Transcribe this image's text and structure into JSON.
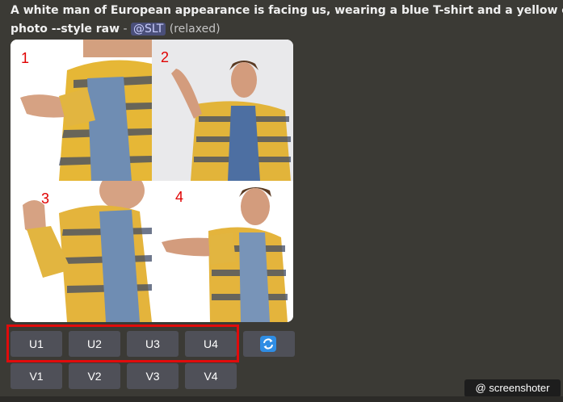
{
  "message": {
    "prompt_text": "A white man of European appearance is facing us, wearing a blue T-shirt and a yellow checkered s",
    "prompt_text_line2": "photo --style raw",
    "separator": " - ",
    "mention": "@SLT",
    "status": "(relaxed)"
  },
  "image_grid": {
    "tiles": [
      {
        "number": "1"
      },
      {
        "number": "2"
      },
      {
        "number": "3"
      },
      {
        "number": "4"
      }
    ]
  },
  "upscale_buttons": [
    "U1",
    "U2",
    "U3",
    "U4"
  ],
  "variation_buttons": [
    "V1",
    "V2",
    "V3",
    "V4"
  ],
  "reroll_button": {
    "icon": "refresh-icon",
    "color": "#2f8de4"
  },
  "watermark": {
    "text": "screenshoter",
    "icon": "at-icon"
  },
  "colors": {
    "background": "#3b3a35",
    "button": "#4f5058",
    "highlight": "#e10b0b",
    "number_labels": "#e00000"
  }
}
